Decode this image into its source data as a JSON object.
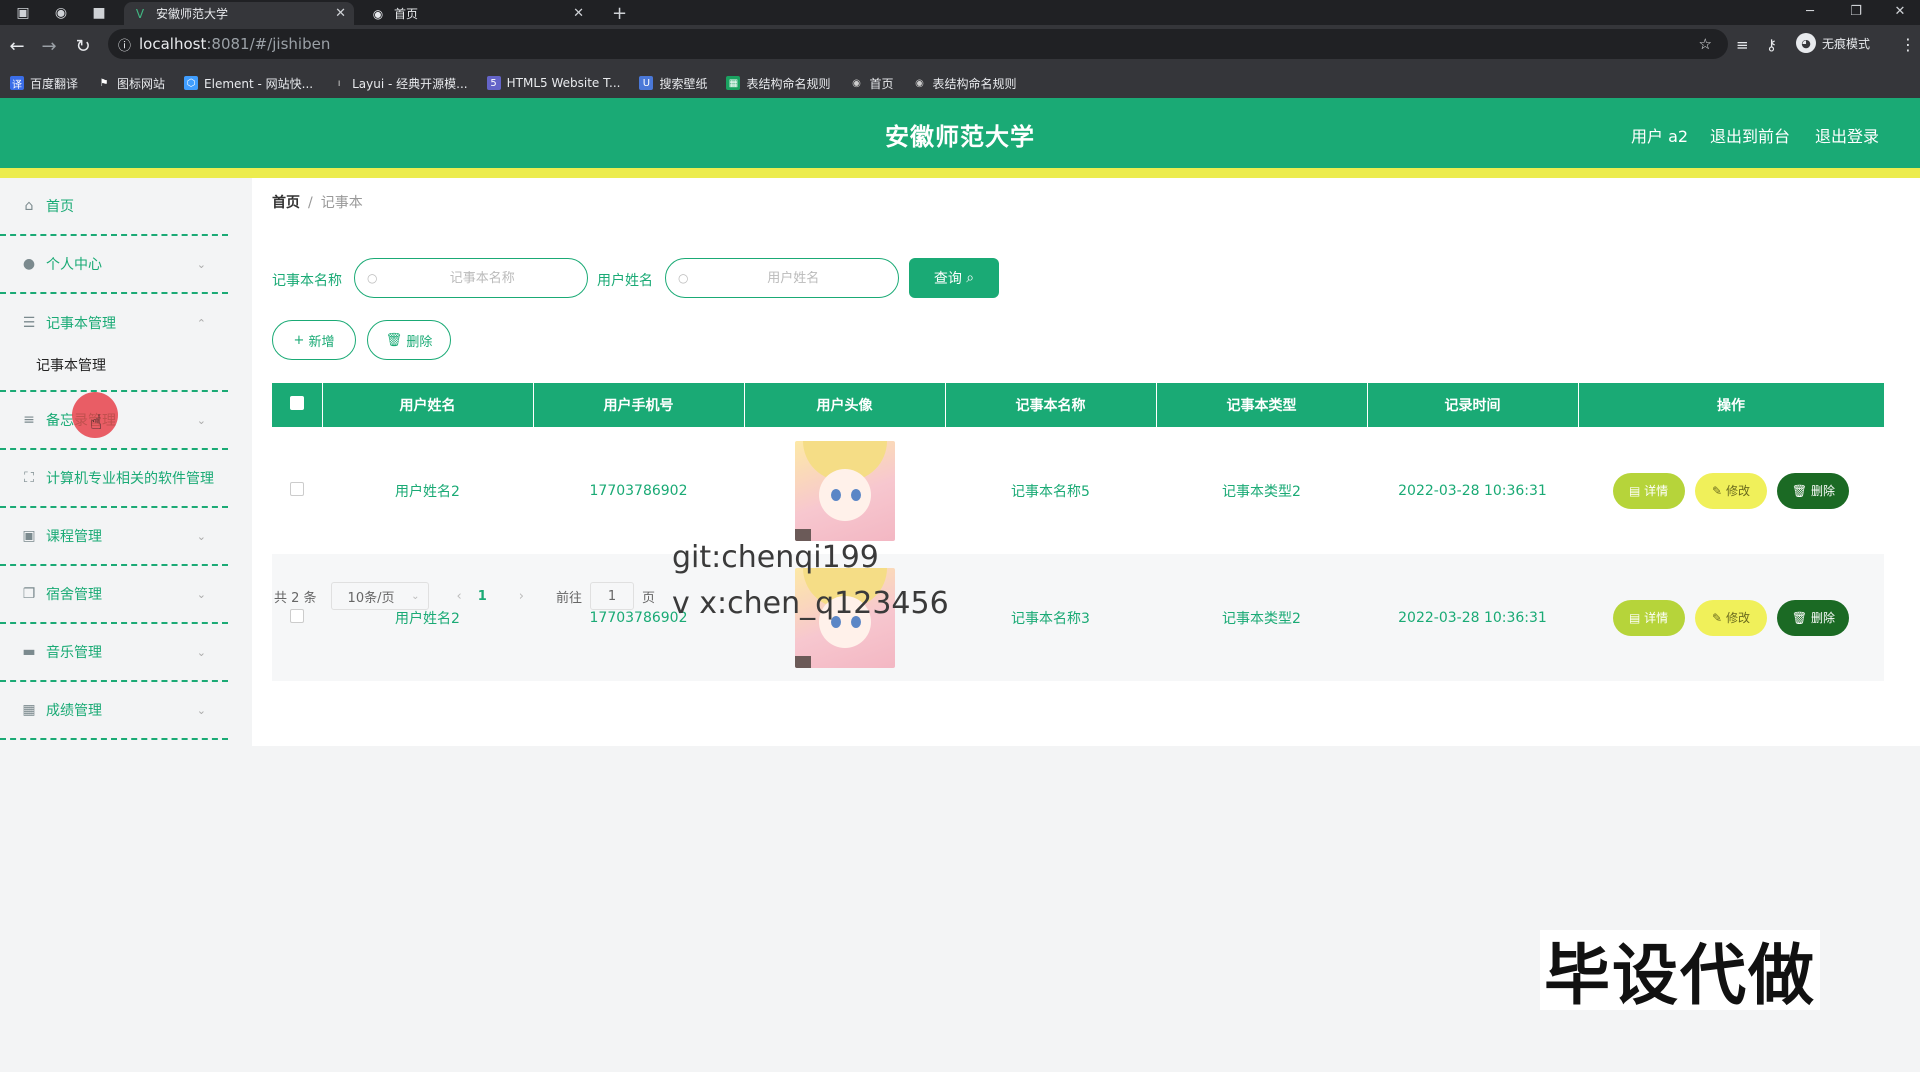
{
  "browser": {
    "tabs": [
      {
        "label": "安徽师范大学",
        "active": true
      },
      {
        "label": "首页",
        "active": false
      }
    ],
    "url_host": "localhost",
    "url_path": ":8081/#/jishiben",
    "profile_label": "无痕模式",
    "bookmarks": [
      {
        "label": "百度翻译",
        "icon": "translate-icon",
        "color": "#3b6ee8"
      },
      {
        "label": "图标网站",
        "icon": "flag-icon",
        "color": "#ffffff"
      },
      {
        "label": "Element - 网站快...",
        "icon": "element-icon",
        "color": "#409eff"
      },
      {
        "label": "Layui - 经典开源模...",
        "icon": "layui-icon",
        "color": "#cccccc"
      },
      {
        "label": "HTML5 Website T...",
        "icon": "html5-icon",
        "color": "#6464c8"
      },
      {
        "label": "搜索壁纸",
        "icon": "wallpaper-icon",
        "color": "#4a78d8"
      },
      {
        "label": "表结构命名规则",
        "icon": "sheet-icon",
        "color": "#1aa260"
      },
      {
        "label": "首页",
        "icon": "globe-icon",
        "color": "#cccccc"
      },
      {
        "label": "表结构命名规则",
        "icon": "globe-icon",
        "color": "#cccccc"
      }
    ]
  },
  "header": {
    "title": "安徽师范大学",
    "user": "用户 a2",
    "back_front": "退出到前台",
    "logout": "退出登录"
  },
  "sidebar": {
    "items": [
      {
        "label": "首页",
        "icon": "home-icon"
      },
      {
        "label": "个人中心",
        "icon": "user-icon"
      },
      {
        "label": "记事本管理",
        "icon": "sliders-icon"
      },
      {
        "label": "备忘录管理",
        "icon": "list-icon"
      },
      {
        "label": "计算机专业相关的软件管理",
        "icon": "expand-icon"
      },
      {
        "label": "课程管理",
        "icon": "course-icon"
      },
      {
        "label": "宿舍管理",
        "icon": "copy-icon"
      },
      {
        "label": "音乐管理",
        "icon": "ticket-icon"
      },
      {
        "label": "成绩管理",
        "icon": "grid-icon"
      }
    ],
    "submenu_label": "记事本管理"
  },
  "breadcrumb": {
    "home": "首页",
    "current": "记事本"
  },
  "search": {
    "name_label": "记事本名称",
    "name_placeholder": "记事本名称",
    "user_label": "用户姓名",
    "user_placeholder": "用户姓名",
    "query_label": "查询"
  },
  "actions": {
    "add": "新增",
    "delete": "删除"
  },
  "table": {
    "columns": [
      "用户姓名",
      "用户手机号",
      "用户头像",
      "记事本名称",
      "记事本类型",
      "记录时间",
      "操作"
    ],
    "rows": [
      {
        "name": "用户姓名2",
        "phone": "17703786902",
        "title": "记事本名称5",
        "type": "记事本类型2",
        "time": "2022-03-28 10:36:31"
      },
      {
        "name": "用户姓名2",
        "phone": "17703786902",
        "title": "记事本名称3",
        "type": "记事本类型2",
        "time": "2022-03-28 10:36:31"
      }
    ],
    "btn_detail": "详情",
    "btn_edit": "修改",
    "btn_delete": "删除"
  },
  "pager": {
    "total": "共 2 条",
    "page_size": "10条/页",
    "current_page": "1",
    "goto_label": "前往",
    "goto_value": "1",
    "page_suffix": "页"
  },
  "watermark": {
    "line1": "git:chenqi199",
    "line2": "v x:chen_q123456",
    "promo": "毕设代做"
  },
  "colors": {
    "brand": "#1aaa75",
    "accent_bar": "#ecec4e",
    "detail_btn": "#b6d43a",
    "edit_btn": "#f0f05a",
    "delete_btn": "#1b6a24"
  }
}
